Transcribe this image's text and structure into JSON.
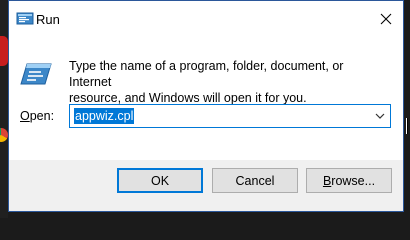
{
  "window": {
    "title": "Run"
  },
  "dialog": {
    "description_line1": "Type the name of a program, folder, document, or Internet",
    "description_line2": "resource, and Windows will open it for you.",
    "open_label_prefix": "",
    "open_label_mnemonic": "O",
    "open_label_rest": "pen:",
    "open_value": "appwiz.cpl"
  },
  "buttons": {
    "ok": "OK",
    "cancel": "Cancel",
    "browse_mnemonic": "B",
    "browse_rest": "rowse..."
  },
  "colors": {
    "accent": "#0078d7",
    "border": "#2b579a",
    "button_face": "#e1e1e1"
  },
  "icons": {
    "title": "run-icon",
    "content": "run-icon",
    "close": "close-icon",
    "dropdown": "chevron-down-icon"
  }
}
